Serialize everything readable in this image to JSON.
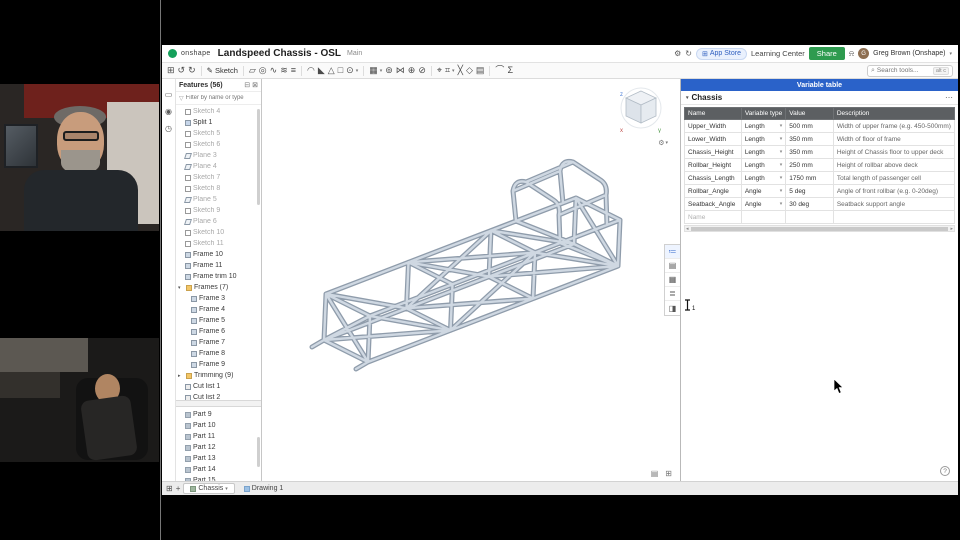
{
  "colors": {
    "onshape_green": "#14a05a",
    "share_green": "#2e9b4f",
    "panel_blue": "#2a62c9",
    "table_header_gray": "#5c5f62"
  },
  "glyphs": {
    "caret_down": "▾",
    "caret_right": "▸",
    "dots": "⋯",
    "grid": "⊞",
    "plus": "+",
    "undo": "↺",
    "redo": "↻",
    "pencil": "✎",
    "search": "⌕",
    "funnel": "▽",
    "gear": "⚙",
    "refresh": "↻",
    "bell": "⍾",
    "collapse": "⊟",
    "close": "⊠",
    "help": "?",
    "scroll_left": "◂",
    "scroll_right": "▸"
  },
  "topbar": {
    "logo_text": "onshape",
    "doc_title": "Landspeed Chassis - OSL",
    "workspace": "Main",
    "app_store_label": "App Store",
    "learning_center_label": "Learning Center",
    "share_label": "Share",
    "user_name": "Greg Brown (Onshape)",
    "user_initial": "G"
  },
  "toolbar": {
    "sketch_label": "Sketch",
    "search_placeholder": "Search tools...",
    "search_shortcut": "alt c",
    "icons": [
      {
        "name": "extrude",
        "glyph": "▱"
      },
      {
        "name": "revolve",
        "glyph": "◎"
      },
      {
        "name": "sweep",
        "glyph": "∿"
      },
      {
        "name": "loft",
        "glyph": "≋"
      },
      {
        "name": "thicken",
        "glyph": "≡",
        "divider": true
      },
      {
        "name": "fillet",
        "glyph": "◠"
      },
      {
        "name": "chamfer",
        "glyph": "◣"
      },
      {
        "name": "draft",
        "glyph": "△"
      },
      {
        "name": "shell",
        "glyph": "□"
      },
      {
        "name": "hole",
        "glyph": "⊙",
        "caret": true,
        "divider": true
      },
      {
        "name": "linear-pattern",
        "glyph": "▦",
        "caret": true
      },
      {
        "name": "circular-pattern",
        "glyph": "⊚"
      },
      {
        "name": "mirror",
        "glyph": "⋈"
      },
      {
        "name": "boolean",
        "glyph": "⊕"
      },
      {
        "name": "split",
        "glyph": "⊘",
        "divider": true
      },
      {
        "name": "transform",
        "glyph": "⌖"
      },
      {
        "name": "frame",
        "glyph": "⌗",
        "caret": true
      },
      {
        "name": "frame-trim",
        "glyph": "╳"
      },
      {
        "name": "tag-profile",
        "glyph": "◇"
      },
      {
        "name": "cut-list",
        "glyph": "▤",
        "divider": true
      },
      {
        "name": "measure",
        "glyph": "⌒"
      },
      {
        "name": "mass-properties",
        "glyph": "Σ"
      }
    ]
  },
  "left_dock": {
    "icons": [
      {
        "name": "comments",
        "glyph": "▭"
      },
      {
        "name": "follow-mode",
        "glyph": "◉"
      },
      {
        "name": "history",
        "glyph": "◷"
      }
    ]
  },
  "features_panel": {
    "title": "Features (56)",
    "filter_placeholder": "Filter by name or type",
    "items": [
      {
        "label": "Sketch 4",
        "icon": "sketch",
        "muted": true
      },
      {
        "label": "Split 1",
        "icon": "split",
        "muted": false
      },
      {
        "label": "Sketch 5",
        "icon": "sketch",
        "muted": true
      },
      {
        "label": "Sketch 6",
        "icon": "sketch",
        "muted": true
      },
      {
        "label": "Plane 3",
        "icon": "plane",
        "muted": true
      },
      {
        "label": "Plane 4",
        "icon": "plane",
        "muted": true
      },
      {
        "label": "Sketch 7",
        "icon": "sketch",
        "muted": true
      },
      {
        "label": "Sketch 8",
        "icon": "sketch",
        "muted": true
      },
      {
        "label": "Plane 5",
        "icon": "plane",
        "muted": true
      },
      {
        "label": "Sketch 9",
        "icon": "sketch",
        "muted": true
      },
      {
        "label": "Plane 6",
        "icon": "plane",
        "muted": true
      },
      {
        "label": "Sketch 10",
        "icon": "sketch",
        "muted": true
      },
      {
        "label": "Sketch 11",
        "icon": "sketch",
        "muted": true
      },
      {
        "label": "Frame 10",
        "icon": "frame"
      },
      {
        "label": "Frame 11",
        "icon": "frame"
      },
      {
        "label": "Frame trim 10",
        "icon": "frame"
      },
      {
        "label": "Frames (7)",
        "folder": true,
        "expanded": true
      },
      {
        "label": "Frame 3",
        "icon": "frame",
        "indent": true
      },
      {
        "label": "Frame 4",
        "icon": "frame",
        "indent": true
      },
      {
        "label": "Frame 5",
        "icon": "frame",
        "indent": true
      },
      {
        "label": "Frame 6",
        "icon": "frame",
        "indent": true
      },
      {
        "label": "Frame 7",
        "icon": "frame",
        "indent": true
      },
      {
        "label": "Frame 8",
        "icon": "frame",
        "indent": true
      },
      {
        "label": "Frame 9",
        "icon": "frame",
        "indent": true
      },
      {
        "label": "Trimming (9)",
        "folder": true,
        "expanded": false
      },
      {
        "label": "Cut list 1",
        "icon": "cutlist"
      },
      {
        "label": "Cut list 2",
        "icon": "cutlist"
      }
    ],
    "parts": [
      "Part 9",
      "Part 10",
      "Part 11",
      "Part 12",
      "Part 13",
      "Part 14",
      "Part 15"
    ]
  },
  "viewport": {
    "viewcube": {
      "axis_x": "x",
      "axis_y": "y",
      "axis_z": "z"
    },
    "dock_icons": [
      {
        "name": "variable-table",
        "glyph": "≔",
        "active": true
      },
      {
        "name": "configurations",
        "glyph": "▤"
      },
      {
        "name": "custom-table",
        "glyph": "▦"
      },
      {
        "name": "bom",
        "glyph": "≣"
      },
      {
        "name": "properties",
        "glyph": "◨"
      }
    ],
    "corner_icons": [
      {
        "name": "section-view",
        "glyph": "▤"
      },
      {
        "name": "named-views",
        "glyph": "⊞"
      }
    ],
    "cursor_badge": "1"
  },
  "variable_table": {
    "panel_title": "Variable table",
    "section_title": "Chassis",
    "columns": [
      "Name",
      "Variable type",
      "Value",
      "Description"
    ],
    "rows": [
      {
        "name": "Upper_Width",
        "type": "Length",
        "value": "500 mm",
        "description": "Width of upper frame (e.g. 450-500mm)"
      },
      {
        "name": "Lower_Width",
        "type": "Length",
        "value": "350 mm",
        "description": "Width of floor of frame"
      },
      {
        "name": "Chassis_Height",
        "type": "Length",
        "value": "350 mm",
        "description": "Height of Chassis floor to upper deck"
      },
      {
        "name": "Rollbar_Height",
        "type": "Length",
        "value": "250 mm",
        "description": "Height of rollbar above deck"
      },
      {
        "name": "Chassis_Length",
        "type": "Length",
        "value": "1750 mm",
        "description": "Total length of passenger cell"
      },
      {
        "name": "Rollbar_Angle",
        "type": "Angle",
        "value": "5 deg",
        "description": "Angle of front rollbar (e.g. 0-20deg)"
      },
      {
        "name": "Seatback_Angle",
        "type": "Angle",
        "value": "30 deg",
        "description": "Seatback support angle"
      }
    ],
    "new_row_placeholder": "Name"
  },
  "tabbar": {
    "tabs": [
      {
        "label": "Chassis",
        "type": "part",
        "active": true
      },
      {
        "label": "Drawing 1",
        "type": "drawing",
        "active": false
      }
    ]
  }
}
